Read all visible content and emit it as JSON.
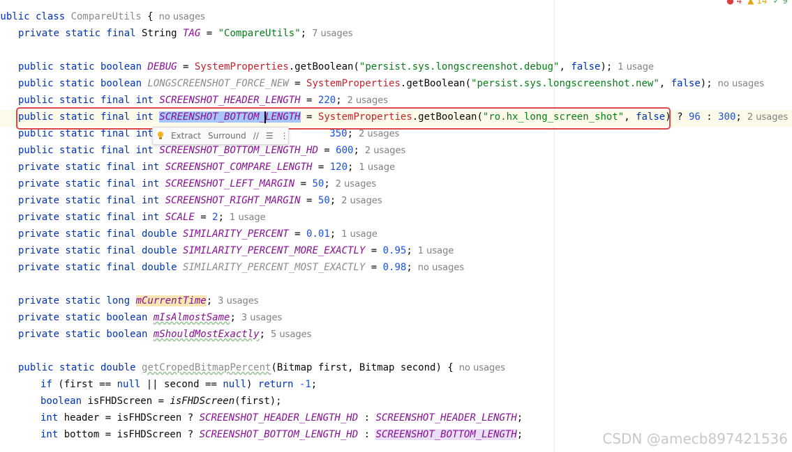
{
  "indicators": {
    "errors": "4",
    "warnings": "14",
    "weak": "9",
    "error_icon": "error-icon",
    "warning_icon": "warning-icon",
    "check_icon": "check-icon"
  },
  "colors": {
    "keyword": "#0033b3",
    "field": "#871094",
    "string": "#067d17",
    "number": "#1750eb",
    "highlight_box": "#e04848"
  },
  "hints": {
    "no_usages": "no usages",
    "u7": "7 usages",
    "u1": "1 usage",
    "u2": "2 usages",
    "u3": "3 usages",
    "u5": "5 usages"
  },
  "code": {
    "l1": {
      "a": "public class ",
      "b": "CompareUtils",
      "c": " {"
    },
    "l2": {
      "a": "private static final ",
      "b": "String ",
      "c": "TAG",
      "d": " = ",
      "e": "\"CompareUtils\"",
      "f": ";"
    },
    "l4": {
      "a": "public static boolean ",
      "b": "DEBUG",
      "c": " = ",
      "d": "SystemProperties",
      "e": ".getBoolean(",
      "f": "\"persist.sys.longscreenshot.debug\"",
      "g": ", ",
      "h": "false",
      "i": ");"
    },
    "l5": {
      "a": "public static boolean ",
      "b": "LONGSCREENSHOT_FORCE_NEW",
      "c": " = ",
      "d": "SystemProperties",
      "e": ".getBoolean(",
      "f": "\"persist.sys.longscreenshot.new\"",
      "g": ", ",
      "h": "false",
      "i": ");"
    },
    "l6": {
      "a": "public static final int ",
      "b": "SCREENSHOT_HEADER_LENGTH",
      "c": " = ",
      "d": "220",
      "e": ";"
    },
    "l7": {
      "a": "public static final int ",
      "b1": "SCREENSHOT_BOTTOM_",
      "b2": "LENGTH",
      "c": " = ",
      "d": "SystemProperties",
      "e": ".getBoolean(",
      "f": "\"ro.hx_long_screen_shot\"",
      "g": ", ",
      "h": "false",
      "i": ") ? ",
      "j": "96",
      "k": " : ",
      "l": "300",
      "m": ";"
    },
    "l8": {
      "a": "public static final int ",
      "d": "350",
      "e": ";"
    },
    "l9": {
      "a": "public static final int ",
      "b": "SCREENSHOT_BOTTOM_LENGTH_HD",
      "c": " = ",
      "d": "600",
      "e": ";"
    },
    "l10": {
      "a": "private static final int ",
      "b": "SCREENSHOT_COMPARE_LENGTH",
      "c": " = ",
      "d": "120",
      "e": ";"
    },
    "l11": {
      "a": "private static final int ",
      "b": "SCREENSHOT_LEFT_MARGIN",
      "c": " = ",
      "d": "50",
      "e": ";"
    },
    "l12": {
      "a": "private static final int ",
      "b": "SCREENSHOT_RIGHT_MARGIN",
      "c": " = ",
      "d": "50",
      "e": ";"
    },
    "l13": {
      "a": "private static final int ",
      "b": "SCALE",
      "c": " = ",
      "d": "2",
      "e": ";"
    },
    "l14": {
      "a": "private static final double ",
      "b": "SIMILARITY_PERCENT",
      "c": " = ",
      "d": "0.01",
      "e": ";"
    },
    "l15": {
      "a": "private static final double ",
      "b": "SIMILARITY_PERCENT_MORE_EXACTLY",
      "c": " = ",
      "d": "0.95",
      "e": ";"
    },
    "l16": {
      "a": "private static final double ",
      "b": "SIMILARITY_PERCENT_MOST_EXACTLY",
      "c": " = ",
      "d": "0.98",
      "e": ";"
    },
    "l18": {
      "a": "private static long ",
      "b": "mCurrentTime",
      "e": ";"
    },
    "l19": {
      "a": "private static boolean ",
      "b": "mIsAlmostSame",
      "e": ";"
    },
    "l20": {
      "a": "private static boolean ",
      "b": "mShouldMostExactly",
      "e": ";"
    },
    "l22": {
      "a": "public static double ",
      "b": "getCropedBitmapPercent",
      "c": "(Bitmap first, Bitmap second) {"
    },
    "l23": {
      "a": "if ",
      "b": "(first == ",
      "c": "null",
      "d": " || second == ",
      "e": "null",
      "f": ") ",
      "g": "return ",
      "h": "-1",
      "i": ";"
    },
    "l24": {
      "a": "boolean ",
      "b": "isFHDScreen = ",
      "c": "isFHDScreen",
      "d": "(first);"
    },
    "l25": {
      "a": "int ",
      "b": "header = isFHDScreen ? ",
      "c": "SCREENSHOT_HEADER_LENGTH_HD",
      "d": " : ",
      "e": "SCREENSHOT_HEADER_LENGTH",
      "f": ";"
    },
    "l26": {
      "a": "int ",
      "b": "bottom = isFHDScreen ? ",
      "c": "SCREENSHOT_BOTTOM_LENGTH_HD",
      "d": " : ",
      "e": "SCREENSHOT_BOTTOM_LENGTH",
      "f": ";"
    }
  },
  "popup": {
    "extract": "Extract",
    "surround": "Surround",
    "bulb_icon": "lightbulb-icon",
    "comment_icon": "comment-icon",
    "format_icon": "format-icon",
    "more_icon": "more-vertical-icon",
    "comment_glyph": "//",
    "more_glyph": "⋮",
    "format_glyph": "☰"
  },
  "watermark": "CSDN @amecb897421536"
}
